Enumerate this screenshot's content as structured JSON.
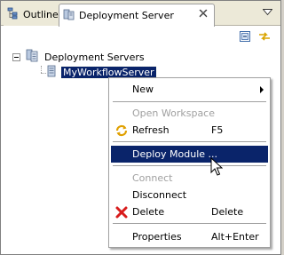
{
  "tabs": {
    "outline_label": "Outline",
    "deploy_label": "Deployment Server"
  },
  "tree": {
    "root_label": "Deployment Servers",
    "child_label": "MyWorkflowServer"
  },
  "menu": {
    "new": "New",
    "open_workspace": "Open Workspace",
    "refresh": "Refresh",
    "refresh_accel": "F5",
    "deploy_module": "Deploy Module ...",
    "connect": "Connect",
    "disconnect": "Disconnect",
    "delete": "Delete",
    "delete_accel": "Delete",
    "properties": "Properties",
    "properties_accel": "Alt+Enter"
  },
  "colors": {
    "selection": "#0a246a",
    "disabled_text": "#a0a0a0",
    "tab_strip": "#ece9d8"
  },
  "icons": [
    "outline-icon",
    "server-icon",
    "close-icon",
    "view-menu-icon",
    "collapse-all-icon",
    "link-with-editor-icon",
    "refresh-icon",
    "delete-icon",
    "cursor-icon"
  ]
}
